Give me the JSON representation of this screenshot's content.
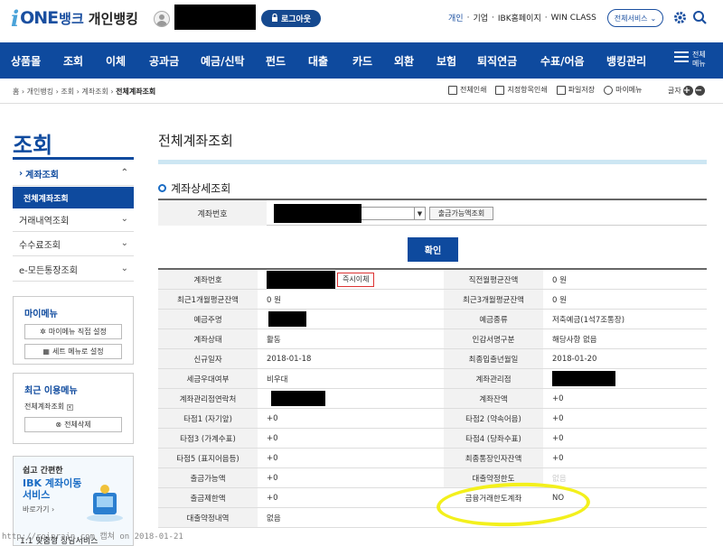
{
  "header": {
    "logo_i": "i",
    "logo_one": "ONE",
    "logo_bank": "뱅크",
    "logo_personal": "개인뱅킹",
    "logout": "로그아웃",
    "links": [
      "개인",
      "기업",
      "IBK홈페이지",
      "WIN CLASS"
    ],
    "all_services": "전체서비스"
  },
  "gnb": {
    "items": [
      "상품몰",
      "조회",
      "이체",
      "공과금",
      "예금/신탁",
      "펀드",
      "대출",
      "카드",
      "외환",
      "보험",
      "퇴직연금",
      "수표/어음",
      "뱅킹관리"
    ],
    "all_menu": "전체메뉴"
  },
  "breadcrumb": {
    "path": "홈 › 개인뱅킹 › 조회 › 계좌조회 ›",
    "current": "전체계좌조회"
  },
  "tools": {
    "print_all": "전체인쇄",
    "print_selected": "지정항목인쇄",
    "save_file": "파일저장",
    "my_menu": "마이메뉴",
    "font": "글자"
  },
  "sidebar": {
    "title": "조회",
    "items": [
      "계좌조회",
      "거래내역조회",
      "수수료조회",
      "e-모든통장조회"
    ],
    "sub_active": "전체계좌조회",
    "mymenu_title": "마이메뉴",
    "mymenu_btn1": "마이메뉴 직접 설정",
    "mymenu_btn2": "세트 메뉴로 설정",
    "recent_title": "최근 이용메뉴",
    "recent_item": "전체계좌조회",
    "recent_delete": "전체삭제",
    "promo_line1": "쉽고 간편한",
    "promo_line2": "IBK 계좌이동 서비스",
    "promo_line3": "바로가기 ›",
    "promo_line4": "1:1 맞춤형 상담서비스"
  },
  "main": {
    "title": "전체계좌조회",
    "section": "계좌상세조회",
    "account_label": "계좌번호",
    "balance_btn": "출금가능액조회",
    "confirm": "확인",
    "instant_transfer": "즉시이체"
  },
  "detail": [
    {
      "k1": "계좌번호",
      "v1": "",
      "k2": "직전월평균잔액",
      "v2": "0 원"
    },
    {
      "k1": "최근1개월평균잔액",
      "v1": "0 원",
      "k2": "최근3개월평균잔액",
      "v2": "0 원"
    },
    {
      "k1": "예금주명",
      "v1": "",
      "k2": "예금종류",
      "v2": "저축예금(1석7조통장)"
    },
    {
      "k1": "계좌상태",
      "v1": "활동",
      "k2": "인감서명구분",
      "v2": "해당사항 없음"
    },
    {
      "k1": "신규일자",
      "v1": "2018-01-18",
      "k2": "최종입출년월일",
      "v2": "2018-01-20"
    },
    {
      "k1": "세금우대여부",
      "v1": "비우대",
      "k2": "계좌관리점",
      "v2": ""
    },
    {
      "k1": "계좌관리점연락처",
      "v1": "",
      "k2": "계좌잔액",
      "v2": "+0"
    },
    {
      "k1": "타점1 (자기앞)",
      "v1": "+0",
      "k2": "타점2 (약속어음)",
      "v2": "+0"
    },
    {
      "k1": "타점3 (가계수표)",
      "v1": "+0",
      "k2": "타점4 (당좌수표)",
      "v2": "+0"
    },
    {
      "k1": "타점5 (표지어음등)",
      "v1": "+0",
      "k2": "최종통장인자잔액",
      "v2": "+0"
    },
    {
      "k1": "출금가능액",
      "v1": "+0",
      "k2": "대출약정한도",
      "v2": "없음"
    },
    {
      "k1": "출금제한액",
      "v1": "+0",
      "k2": "금융거래한도계좌",
      "v2": "NO"
    },
    {
      "k1": "대출약정내역",
      "v1": "없음",
      "k2": "",
      "v2": ""
    }
  ],
  "watermark": "http://roinrain.com 캡쳐 on 2018-01-21"
}
